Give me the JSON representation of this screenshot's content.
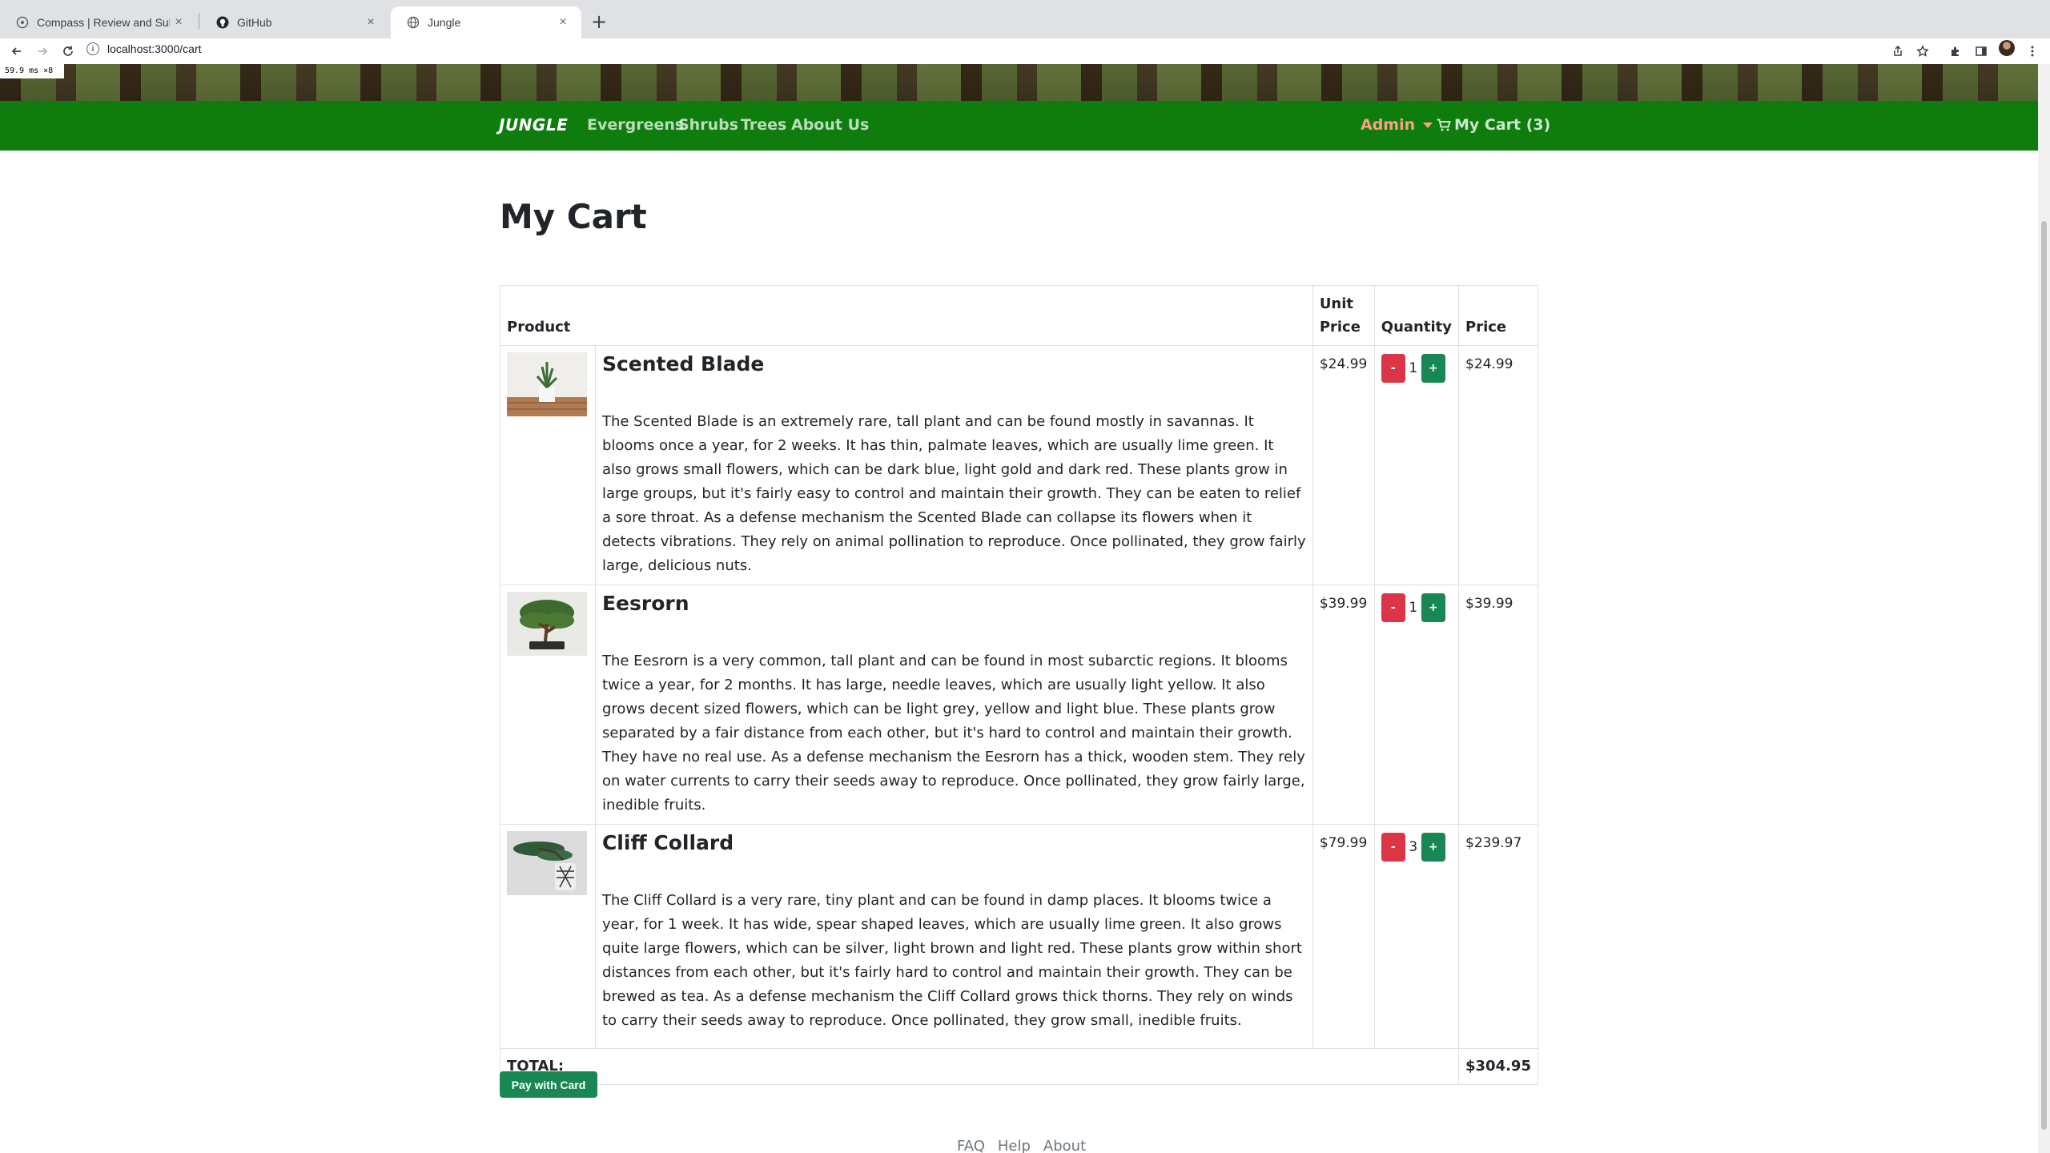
{
  "browser": {
    "tabs": [
      {
        "title": "Compass | Review and Submit",
        "active": false
      },
      {
        "title": "GitHub",
        "active": false
      },
      {
        "title": "Jungle",
        "active": true
      }
    ],
    "url": "localhost:3000/cart"
  },
  "overlay": {
    "fps": "59.9 ms ×8"
  },
  "navbar": {
    "brand": "JUNGLE",
    "links": [
      "Evergreens",
      "Shrubs",
      "Trees",
      "About Us"
    ],
    "admin_label": "Admin",
    "cart_label": "My Cart (3)"
  },
  "page": {
    "title": "My Cart"
  },
  "table": {
    "headers": {
      "product": "Product",
      "unit_price": "Unit Price",
      "quantity": "Quantity",
      "price": "Price"
    },
    "rows": [
      {
        "name": "Scented Blade",
        "description": "The Scented Blade is an extremely rare, tall plant and can be found mostly in savannas. It blooms once a year, for 2 weeks. It has thin, palmate leaves, which are usually lime green. It also grows small flowers, which can be dark blue, light gold and dark red. These plants grow in large groups, but it's fairly easy to control and maintain their growth. They can be eaten to relief a sore throat. As a defense mechanism the Scented Blade can collapse its flowers when it detects vibrations. They rely on animal pollination to reproduce. Once pollinated, they grow fairly large, delicious nuts.",
        "unit_price": "$24.99",
        "quantity": "1",
        "price": "$24.99"
      },
      {
        "name": "Eesrorn",
        "description": "The Eesrorn is a very common, tall plant and can be found in most subarctic regions. It blooms twice a year, for 2 months. It has large, needle leaves, which are usually light yellow. It also grows decent sized flowers, which can be light grey, yellow and light blue. These plants grow separated by a fair distance from each other, but it's hard to control and maintain their growth. They have no real use. As a defense mechanism the Eesrorn has a thick, wooden stem. They rely on water currents to carry their seeds away to reproduce. Once pollinated, they grow fairly large, inedible fruits.",
        "unit_price": "$39.99",
        "quantity": "1",
        "price": "$39.99"
      },
      {
        "name": "Cliff Collard",
        "description": "The Cliff Collard is a very rare, tiny plant and can be found in damp places. It blooms twice a year, for 1 week. It has wide, spear shaped leaves, which are usually lime green. It also grows quite large flowers, which can be silver, light brown and light red. These plants grow within short distances from each other, but it's fairly hard to control and maintain their growth. They can be brewed as tea. As a defense mechanism the Cliff Collard grows thick thorns. They rely on winds to carry their seeds away to reproduce. Once pollinated, they grow small, inedible fruits.",
        "unit_price": "$79.99",
        "quantity": "3",
        "price": "$239.97"
      }
    ],
    "minus_label": "-",
    "plus_label": "+",
    "total_label": "TOTAL:",
    "total_value": "$304.95"
  },
  "pay_button": "Pay with Card",
  "footer": {
    "links": [
      "FAQ",
      "Help",
      "About"
    ]
  },
  "colors": {
    "navbar": "#0e7d0e",
    "admin": "#ff9f86",
    "minus": "#dc3545",
    "plus": "#198754",
    "pay": "#198754"
  },
  "icons": [
    "info-icon",
    "back-icon",
    "forward-icon",
    "reload-icon",
    "share-icon",
    "star-icon",
    "extensions-icon",
    "sidepanel-icon",
    "menu-icon",
    "cart-icon",
    "github-icon",
    "globe-icon"
  ]
}
